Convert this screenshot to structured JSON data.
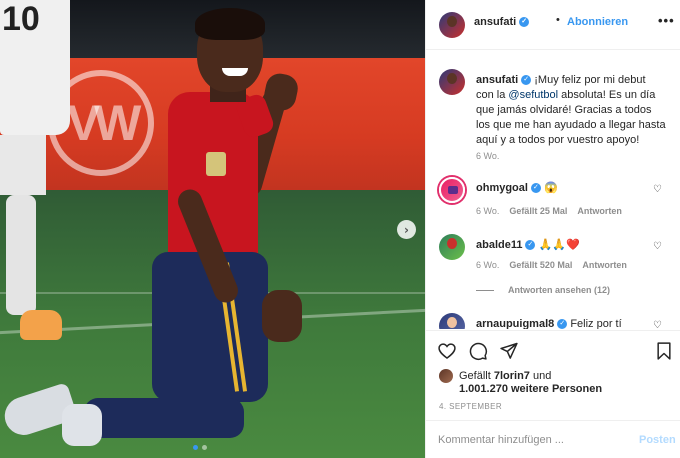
{
  "photo": {
    "background_player_number": "10",
    "next_icon": "chevron-right-icon",
    "carousel_dots": 2,
    "carousel_active_index": 0
  },
  "header": {
    "username": "ansufati",
    "separator": "•",
    "follow_label": "Abonnieren",
    "more_icon": "•••"
  },
  "caption": {
    "username": "ansufati",
    "text_before_mention": "¡Muy feliz por mi debut con la ",
    "mention": "@sefutbol",
    "text_after_mention": " absoluta! Es un día que jamás olvidaré! Gracias a todos los que me han ayudado a llegar hasta aquí y a todos por vuestro apoyo!",
    "time": "6 Wo."
  },
  "comments": [
    {
      "username": "ohmygoal",
      "text": "😱",
      "time": "6 Wo.",
      "likes": "Gefällt 25 Mal",
      "reply": "Antworten"
    },
    {
      "username": "abalde11",
      "text": "🙏🙏❤️",
      "time": "6 Wo.",
      "likes": "Gefällt 520 Mal",
      "reply": "Antworten"
    },
    {
      "username": "arnaupuigmal8",
      "text": "Feliz por tí"
    }
  ],
  "view_replies": "Antworten ansehen (12)",
  "actions": {
    "like_icon": "heart-icon",
    "comment_icon": "comment-icon",
    "share_icon": "share-icon",
    "save_icon": "bookmark-icon"
  },
  "likes": {
    "prefix": "Gefällt ",
    "first_user": "7lorin7",
    "connector": " und",
    "count": "1.001.270",
    "suffix": " weitere Personen"
  },
  "date": "4. SEPTEMBER",
  "add_comment": {
    "placeholder": "Kommentar hinzufügen ...",
    "post_label": "Posten"
  },
  "colors": {
    "accent": "#3897f0",
    "post_disabled": "#b3dbff",
    "text": "#262626",
    "muted": "#8e8e8e"
  }
}
